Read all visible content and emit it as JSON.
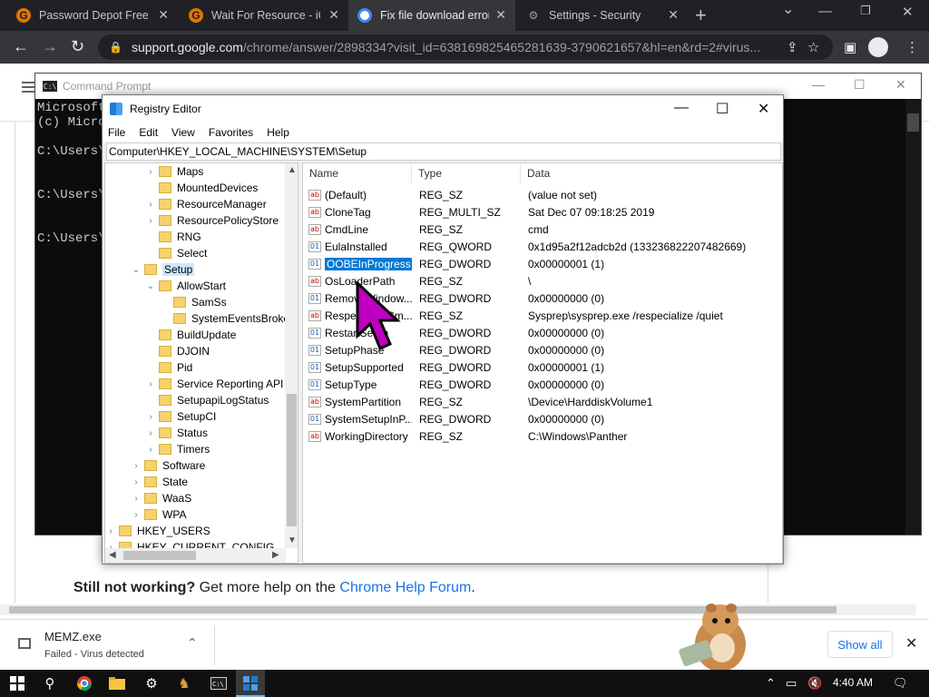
{
  "browser": {
    "tabs": [
      {
        "title": "Password Depot Free D",
        "favicon": "g-icon"
      },
      {
        "title": "Wait For Resource - iGe",
        "favicon": "g-icon"
      },
      {
        "title": "Fix file download error",
        "favicon": "google-icon"
      },
      {
        "title": "Settings - Security",
        "favicon": "gear-icon"
      }
    ],
    "close_glyph": "✕",
    "new_tab_glyph": "+",
    "url_host": "support.google.com",
    "url_rest": "/chrome/answer/2898334?visit_id=638169825465281639-3790621657&hl=en&rd=2#virus..."
  },
  "page": {
    "still_bold": "Still not working?",
    "still_text": " Get more help on the ",
    "still_link": "Chrome Help Forum",
    "still_end": "."
  },
  "cmd": {
    "title": "Command Prompt",
    "lines": [
      "Microsoft",
      "(c) Micro",
      "C:\\Users\\",
      "C:\\Users\\",
      "C:\\Users\\"
    ]
  },
  "regedit": {
    "title": "Registry Editor",
    "menu": [
      "File",
      "Edit",
      "View",
      "Favorites",
      "Help"
    ],
    "address": "Computer\\HKEY_LOCAL_MACHINE\\SYSTEM\\Setup",
    "tree": [
      {
        "label": "Maps",
        "exp": "›"
      },
      {
        "label": "MountedDevices",
        "exp": ""
      },
      {
        "label": "ResourceManager",
        "exp": "›"
      },
      {
        "label": "ResourcePolicyStore",
        "exp": "›"
      },
      {
        "label": "RNG",
        "exp": ""
      },
      {
        "label": "Select",
        "exp": ""
      },
      {
        "label": "Setup",
        "exp": "⌄"
      },
      {
        "label": "AllowStart",
        "exp": "⌄"
      },
      {
        "label": "SamSs",
        "exp": ""
      },
      {
        "label": "SystemEventsBroke",
        "exp": ""
      },
      {
        "label": "BuildUpdate",
        "exp": ""
      },
      {
        "label": "DJOIN",
        "exp": ""
      },
      {
        "label": "Pid",
        "exp": ""
      },
      {
        "label": "Service Reporting API",
        "exp": "›"
      },
      {
        "label": "SetupapiLogStatus",
        "exp": ""
      },
      {
        "label": "SetupCI",
        "exp": "›"
      },
      {
        "label": "Status",
        "exp": "›"
      },
      {
        "label": "Timers",
        "exp": "›"
      },
      {
        "label": "Software",
        "exp": "›"
      },
      {
        "label": "State",
        "exp": "›"
      },
      {
        "label": "WaaS",
        "exp": "›"
      },
      {
        "label": "WPA",
        "exp": "›"
      },
      {
        "label": "HKEY_USERS",
        "exp": "›"
      },
      {
        "label": "HKEY_CURRENT_CONFIG",
        "exp": "›"
      }
    ],
    "columns": [
      "Name",
      "Type",
      "Data"
    ],
    "values": [
      {
        "name": "(Default)",
        "type": "REG_SZ",
        "data": "(value not set)",
        "icon": "ab"
      },
      {
        "name": "CloneTag",
        "type": "REG_MULTI_SZ",
        "data": "Sat Dec 07 09:18:25 2019",
        "icon": "ab"
      },
      {
        "name": "CmdLine",
        "type": "REG_SZ",
        "data": "cmd",
        "icon": "ab"
      },
      {
        "name": "EulaInstalled",
        "type": "REG_QWORD",
        "data": "0x1d95a2f12adcb2d (133236822207482669)",
        "icon": "01"
      },
      {
        "name": "OOBEInProgress",
        "type": "REG_DWORD",
        "data": "0x00000001 (1)",
        "icon": "01"
      },
      {
        "name": "OsLoaderPath",
        "type": "REG_SZ",
        "data": "\\",
        "icon": "ab"
      },
      {
        "name": "RemoveWindow...",
        "type": "REG_DWORD",
        "data": "0x00000000 (0)",
        "icon": "01"
      },
      {
        "name": "RespecializeCm...",
        "type": "REG_SZ",
        "data": "Sysprep\\sysprep.exe /respecialize /quiet",
        "icon": "ab"
      },
      {
        "name": "RestartSetup",
        "type": "REG_DWORD",
        "data": "0x00000000 (0)",
        "icon": "01"
      },
      {
        "name": "SetupPhase",
        "type": "REG_DWORD",
        "data": "0x00000000 (0)",
        "icon": "01"
      },
      {
        "name": "SetupSupported",
        "type": "REG_DWORD",
        "data": "0x00000001 (1)",
        "icon": "01"
      },
      {
        "name": "SetupType",
        "type": "REG_DWORD",
        "data": "0x00000000 (0)",
        "icon": "01"
      },
      {
        "name": "SystemPartition",
        "type": "REG_SZ",
        "data": "\\Device\\HarddiskVolume1",
        "icon": "ab"
      },
      {
        "name": "SystemSetupInP...",
        "type": "REG_DWORD",
        "data": "0x00000000 (0)",
        "icon": "01"
      },
      {
        "name": "WorkingDirectory",
        "type": "REG_SZ",
        "data": "C:\\Windows\\Panther",
        "icon": "ab"
      }
    ]
  },
  "download": {
    "file": "MEMZ.exe",
    "status": "Failed - Virus detected",
    "show_all": "Show all"
  },
  "taskbar": {
    "time": "4:40 AM"
  },
  "colors": {
    "selection": "#0078d7",
    "link": "#1a73e8",
    "cursor": "#c000c0"
  }
}
